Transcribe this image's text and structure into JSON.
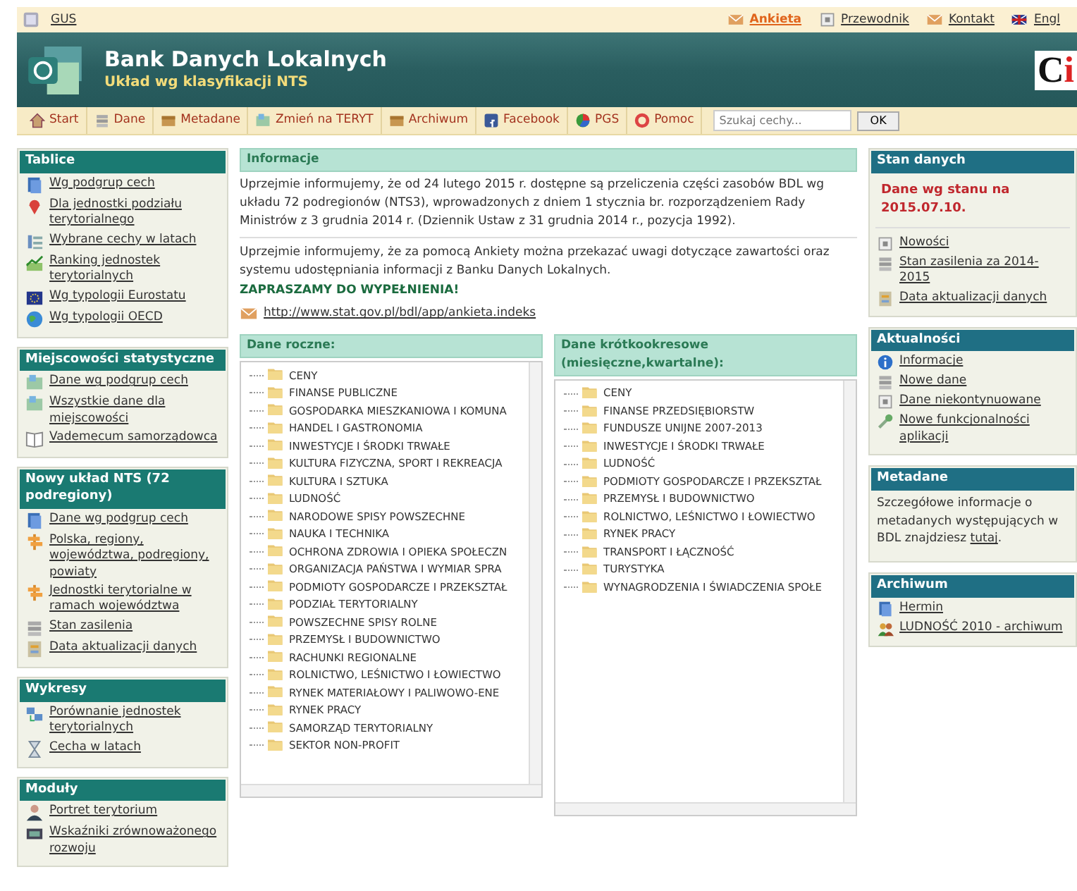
{
  "top_bar": {
    "site": "GUS",
    "links": [
      {
        "label": "Ankieta",
        "highlighted": true
      },
      {
        "label": "Przewodnik",
        "highlighted": false
      },
      {
        "label": "Kontakt",
        "highlighted": false
      },
      {
        "label": "Engl",
        "highlighted": false
      }
    ]
  },
  "header": {
    "title": "Bank Danych Lokalnych",
    "subtitle": "Układ wg klasyfikacji NTS",
    "logo_text": "Ci"
  },
  "nav": {
    "items": [
      "Start",
      "Dane",
      "Metadane",
      "Zmień na TERYT",
      "Archiwum",
      "Facebook",
      "PGS",
      "Pomoc"
    ],
    "search": {
      "placeholder": "Szukaj cechy..."
    },
    "button": "OK"
  },
  "left_panels": [
    {
      "title": "Tablice",
      "items": [
        "Wg podgrup cech",
        "Dla jednostki podziału terytorialnego",
        "Wybrane cechy w latach",
        "Ranking jednostek terytorialnych",
        "Wg typologii Eurostatu",
        "Wg typologii OECD"
      ]
    },
    {
      "title": "Miejscowości statystyczne",
      "items": [
        "Dane wg podgrup cech",
        "Wszystkie dane dla miejscowości",
        "Vademecum samorządowca"
      ]
    },
    {
      "title": "Nowy układ NTS (72 podregiony)",
      "items": [
        "Dane wg podgrup cech",
        "Polska, regiony, województwa, podregiony, powiaty",
        "Jednostki terytorialne w ramach województwa",
        "Stan zasilenia",
        "Data aktualizacji danych"
      ]
    },
    {
      "title": "Wykresy",
      "items": [
        "Porównanie jednostek terytorialnych",
        "Cecha w latach"
      ]
    },
    {
      "title": "Moduły",
      "items": [
        "Portret terytorium",
        "Wskaźniki zrównoważonego rozwoju"
      ]
    }
  ],
  "info": {
    "title": "Informacje",
    "paragraphs": [
      "Uprzejmie informujemy, że od 24 lutego 2015 r. dostępne są przeliczenia części zasobów BDL wg układu 72 podregionów (NTS3), wprowadzonych z dniem 1 stycznia br. rozporządzeniem Rady Ministrów z 3 grudnia 2014 r. (Dziennik Ustaw z 31 grudnia 2014 r., pozycja 1992).",
      "Uprzejmie informujemy, że za pomocą Ankiety można przekazać uwagi dotyczące zawartości oraz systemu udostępniania informacji z Banku Danych Lokalnych."
    ],
    "call": "ZAPRASZAMY DO WYPEŁNIENIA!",
    "link": "http://www.stat.gov.pl/bdl/app/ankieta.indeks"
  },
  "trees": [
    {
      "title": "Dane roczne:",
      "horizontal_scroll": true,
      "items": [
        "CENY",
        "FINANSE PUBLICZNE",
        "GOSPODARKA MIESZKANIOWA I KOMUNA",
        "HANDEL I GASTRONOMIA",
        "INWESTYCJE I ŚRODKI TRWAŁE",
        "KULTURA FIZYCZNA, SPORT I REKREACJA",
        "KULTURA I SZTUKA",
        "LUDNOŚĆ",
        "NARODOWE SPISY POWSZECHNE",
        "NAUKA I TECHNIKA",
        "OCHRONA ZDROWIA I OPIEKA SPOŁECZN",
        "ORGANIZACJA PAŃSTWA I WYMIAR SPRA",
        "PODMIOTY GOSPODARCZE I PRZEKSZTAŁ",
        "PODZIAŁ TERYTORIALNY",
        "POWSZECHNE SPISY ROLNE",
        "PRZEMYSŁ I BUDOWNICTWO",
        "RACHUNKI REGIONALNE",
        "ROLNICTWO, LEŚNICTWO I ŁOWIECTWO",
        "RYNEK MATERIAŁOWY I PALIWOWO-ENE",
        "RYNEK PRACY",
        "SAMORZĄD TERYTORIALNY",
        "SEKTOR NON-PROFIT"
      ]
    },
    {
      "title": "Dane krótkookresowe (miesięczne,kwartalne):",
      "horizontal_scroll": true,
      "items": [
        "CENY",
        "FINANSE PRZEDSIĘBIORSTW",
        "FUNDUSZE UNIJNE 2007-2013",
        "INWESTYCJE I ŚRODKI TRWAŁE",
        "LUDNOŚĆ",
        "PODMIOTY GOSPODARCZE I PRZEKSZTAŁ",
        "PRZEMYSŁ I BUDOWNICTWO",
        "ROLNICTWO, LEŚNICTWO I ŁOWIECTWO",
        "RYNEK PRACY",
        "TRANSPORT I ŁĄCZNOŚĆ",
        "TURYSTYKA",
        "WYNAGRODZENIA I ŚWIADCZENIA SPOŁE"
      ]
    }
  ],
  "right_panels": [
    {
      "title": "Stan danych",
      "status": "Dane wg stanu na 2015.07.10.",
      "items": [
        "Nowości",
        "Stan zasilenia za 2014-2015",
        "Data aktualizacji danych"
      ]
    },
    {
      "title": "Aktualności",
      "items": [
        "Informacje",
        "Nowe dane",
        "Dane niekontynuowane",
        "Nowe funkcjonalności aplikacji"
      ]
    },
    {
      "title": "Metadane",
      "text_before": "Szczegółowe informacje o metadanych występujących w BDL znajdziesz ",
      "link": "tutaj",
      "text_after": "."
    },
    {
      "title": "Archiwum",
      "items": [
        "Hermin",
        "LUDNOŚĆ 2010 - archiwum"
      ]
    }
  ]
}
